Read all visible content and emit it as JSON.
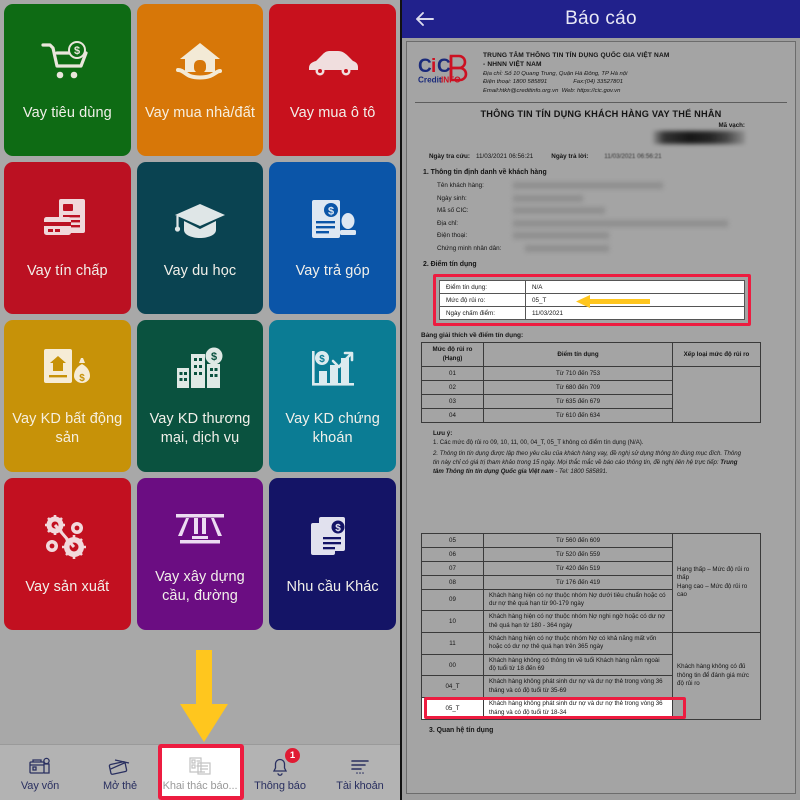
{
  "left_app": {
    "tiles": [
      {
        "label": "Vay tiêu dùng",
        "color": "#0e6b14",
        "icon": "shopping-cart-money-icon"
      },
      {
        "label": "Vay mua nhà/đất",
        "color": "#d77708",
        "icon": "house-in-hand-icon"
      },
      {
        "label": "Vay mua ô tô",
        "color": "#c8111d",
        "icon": "car-icon"
      },
      {
        "label": "Vay tín chấp",
        "color": "#bb1122",
        "icon": "credit-card-documents-icon"
      },
      {
        "label": "Vay du học",
        "color": "#0a4351",
        "icon": "graduation-cap-icon"
      },
      {
        "label": "Vay trả góp",
        "color": "#0b55a8",
        "icon": "document-money-stamp-icon"
      },
      {
        "label": "Vay KD bất động sản",
        "color": "#c79208",
        "icon": "realestate-moneybag-icon"
      },
      {
        "label": "Vay KD thương mại, dịch vụ",
        "color": "#0a523f",
        "icon": "buildings-money-icon"
      },
      {
        "label": "Vay KD chứng khoán",
        "color": "#0b7c94",
        "icon": "bar-chart-money-icon"
      },
      {
        "label": "Vay sản xuất",
        "color": "#c21020",
        "icon": "gears-icon"
      },
      {
        "label": "Vay xây dựng cầu, đường",
        "color": "#6b0d82",
        "icon": "bridge-road-icon"
      },
      {
        "label": "Nhu cầu Khác",
        "color": "#141466",
        "icon": "documents-money-icon"
      }
    ],
    "bottom_nav": [
      {
        "label": "Vay vốn",
        "icon": "bank-money-icon",
        "active": false,
        "badge": ""
      },
      {
        "label": "Mở thẻ",
        "icon": "cards-icon",
        "active": false,
        "badge": ""
      },
      {
        "label": "Khai thác báo...",
        "icon": "report-extract-icon",
        "active": true,
        "badge": ""
      },
      {
        "label": "Thông báo",
        "icon": "bell-icon",
        "active": false,
        "badge": "1"
      },
      {
        "label": "Tài khoản",
        "icon": "menu-account-icon",
        "active": false,
        "badge": ""
      }
    ],
    "pointer_arrow": "down-arrow-indicator",
    "highlight_color": "#ed1c40",
    "arrow_color": "#ffc61e"
  },
  "report_app": {
    "header": {
      "title": "Báo cáo",
      "back_icon": "back-arrow-icon",
      "bar_color": "#21218c"
    },
    "document": {
      "logo": {
        "main_text": "CiCB",
        "sub_text": "CreditINFO"
      },
      "org_name_line1": "TRUNG TÂM THÔNG TIN TÍN DỤNG QUỐC GIA VIỆT NAM",
      "org_name_line2": "- NHNN VIỆT NAM",
      "org_address": "Địa chỉ: Số 10 Quang Trung, Quận Hà Đông, TP Hà nội",
      "org_phone_label": "Điện thoại: 1800 585891",
      "org_fax_label": "Fax:(04) 33527801",
      "org_email_label": "Email:htkh@creditinfo.org.vn",
      "org_web_label": "Web: https://cic.gov.vn",
      "doc_title": "THÔNG TIN TÍN DỤNG KHÁCH HÀNG VAY THỂ NHÂN",
      "barcode_label": "Mã vạch:",
      "lookup_date_label": "Ngày tra cứu:",
      "lookup_date_value": "11/03/2021 06:56:21",
      "reply_date_label": "Ngày trả lời:",
      "reply_date_value": "11/03/2021 06:56:21",
      "section1_title": "1. Thông tin định danh về khách hàng",
      "identity_fields": [
        {
          "label": "Tên khách hàng:",
          "value": ""
        },
        {
          "label": "Ngày sinh:",
          "value": ""
        },
        {
          "label": "Mã số CIC:",
          "value": ""
        },
        {
          "label": "Địa chỉ:",
          "value": ""
        },
        {
          "label": "Điện thoại:",
          "value": ""
        },
        {
          "label": "Chứng minh nhân dân:",
          "value": ""
        }
      ],
      "section2_title": "2. Điểm tín dụng",
      "score_box": [
        {
          "key": "Điểm tín dụng:",
          "value": "N/A"
        },
        {
          "key": "Mức độ rủi ro:",
          "value": "05_T"
        },
        {
          "key": "Ngày chấm điểm:",
          "value": "11/03/2021"
        }
      ],
      "table_caption": "Bảng giải thích về điểm tín dụng:",
      "table_headers": {
        "rank": "Mức độ rủi ro (Hạng)",
        "score": "Điểm tín dụng",
        "classification": "Xếp loại mức độ rủi ro"
      },
      "table_rows_top": [
        {
          "rank": "01",
          "score": "Từ 710 đến 753"
        },
        {
          "rank": "02",
          "score": "Từ 680 đến 709"
        },
        {
          "rank": "03",
          "score": "Từ 635 đến 679"
        },
        {
          "rank": "04",
          "score": "Từ 610 đến 634"
        }
      ],
      "notes_title": "Lưu ý:",
      "note_1": "1. Các mức độ rủi ro 09, 10, 11, 00, 04_T, 05_T không có điểm tín dụng (N/A).",
      "note_2_part1": "2. Thông tin tín dụng được lập theo yêu cầu của khách hàng vay, đề nghị sử dụng thông tin đúng mục đích. Thông tin này chỉ có giá trị tham khảo trong 15 ngày. Mọi thắc mắc về báo cáo thông tin, đề nghị liên hệ trực tiếp: ",
      "note_2_bold": "Trung tâm Thông tin tín dụng Quốc gia Việt nam",
      "note_2_part2": " - Tel: 1800 585891.",
      "table_rows_bottom": [
        {
          "rank": "05",
          "desc": "Từ 560 đến 609",
          "centered": true
        },
        {
          "rank": "06",
          "desc": "Từ 520 đến 559",
          "centered": true
        },
        {
          "rank": "07",
          "desc": "Từ 420 đến 519",
          "centered": true
        },
        {
          "rank": "08",
          "desc": "Từ 176 đến 419",
          "centered": true
        },
        {
          "rank": "09",
          "desc": "Khách hàng hiện có nợ thuộc nhóm Nợ dưới tiêu chuẩn hoặc có dư nợ thẻ quá hạn từ 90-179 ngày",
          "centered": false
        },
        {
          "rank": "10",
          "desc": "Khách hàng hiện có nợ thuộc nhóm Nợ nghi ngờ hoặc có dư nợ thẻ quá hạn từ 180 - 364 ngày",
          "centered": false
        },
        {
          "rank": "11",
          "desc": "Khách hàng hiện có nợ thuộc nhóm Nợ có khả năng mất vốn hoặc có dư nợ thẻ quá hạn trên 365 ngày",
          "centered": false
        },
        {
          "rank": "00",
          "desc": "Khách hàng không có thông tin về tuổi Khách hàng nằm ngoài độ tuổi từ 18 đến 69",
          "centered": false
        },
        {
          "rank": "04_T",
          "desc": "Khách hàng không phát sinh dư nợ và dư nợ thẻ trong vòng 36 tháng và có độ tuổi từ 35-69",
          "centered": false
        },
        {
          "rank": "05_T",
          "desc": "Khách hàng không phát sinh dư nợ và dư nợ thẻ trong vòng 36 tháng và có độ tuổi từ 18-34",
          "centered": false
        }
      ],
      "class_low_high": "Hạng thấp – Mức độ rủi ro thấp\nHạng cao – Mức độ rủi ro cao",
      "class_no_info": "Khách hàng không có đủ thông tin để đánh giá mức độ rủi ro",
      "section3_title": "3. Quan hệ tín dụng"
    }
  }
}
